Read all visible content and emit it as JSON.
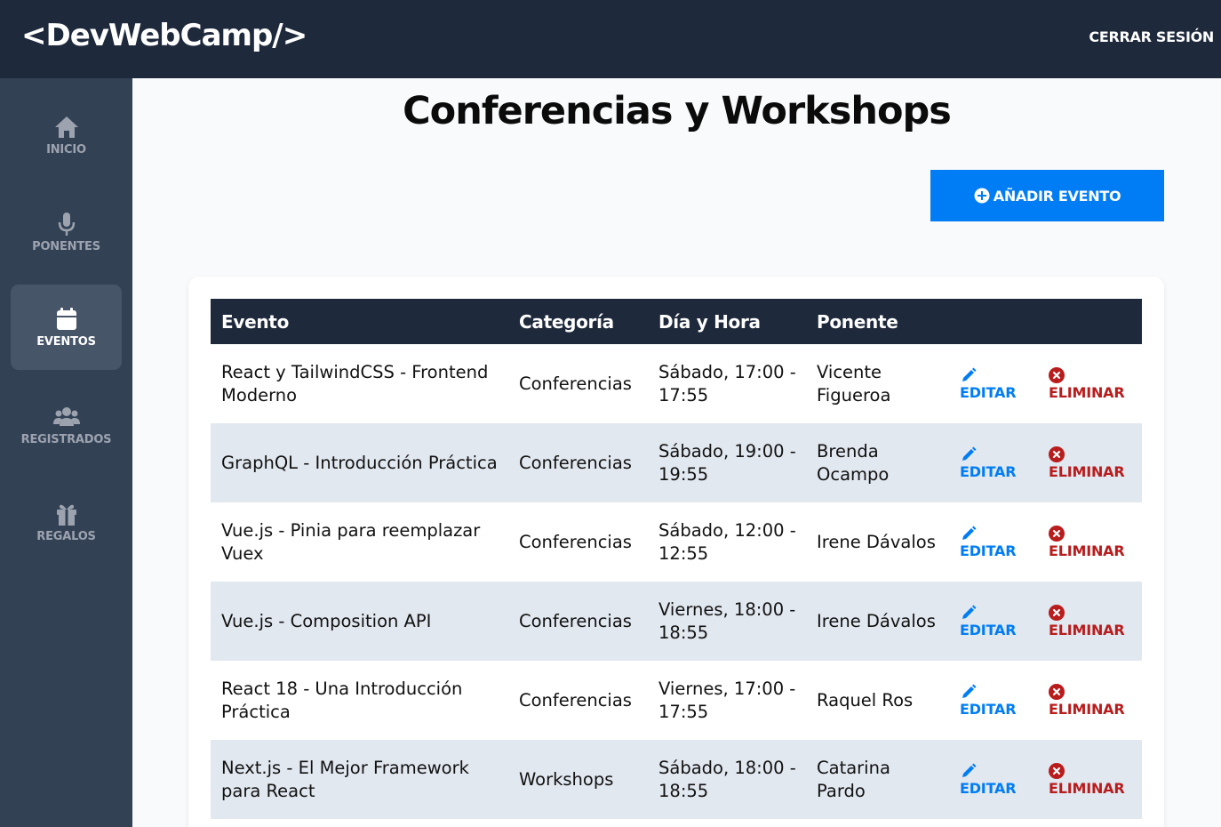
{
  "header": {
    "logo": "<DevWebCamp/>",
    "logout": "CERRAR SESIÓN"
  },
  "sidebar": {
    "items": [
      {
        "label": "INICIO",
        "icon": "home-icon"
      },
      {
        "label": "PONENTES",
        "icon": "microphone-icon"
      },
      {
        "label": "EVENTOS",
        "icon": "calendar-icon",
        "active": true
      },
      {
        "label": "REGISTRADOS",
        "icon": "users-icon"
      },
      {
        "label": "REGALOS",
        "icon": "gift-icon"
      }
    ]
  },
  "main": {
    "title": "Conferencias y Workshops",
    "add_button": "AÑADIR EVENTO",
    "table": {
      "headers": [
        "Evento",
        "Categoría",
        "Día y Hora",
        "Ponente"
      ],
      "edit_label": "EDITAR",
      "delete_label": "ELIMINAR",
      "rows": [
        {
          "evento": "React y TailwindCSS - Frontend Moderno",
          "categoria": "Conferencias",
          "dia_hora": "Sábado, 17:00 - 17:55",
          "ponente": "Vicente Figueroa"
        },
        {
          "evento": "GraphQL - Introducción Práctica",
          "categoria": "Conferencias",
          "dia_hora": "Sábado, 19:00 - 19:55",
          "ponente": "Brenda Ocampo"
        },
        {
          "evento": "Vue.js - Pinia para reemplazar Vuex",
          "categoria": "Conferencias",
          "dia_hora": "Sábado, 12:00 - 12:55",
          "ponente": "Irene Dávalos"
        },
        {
          "evento": "Vue.js - Composition API",
          "categoria": "Conferencias",
          "dia_hora": "Viernes, 18:00 - 18:55",
          "ponente": "Irene Dávalos"
        },
        {
          "evento": "React 18 - Una Introducción Práctica",
          "categoria": "Conferencias",
          "dia_hora": "Viernes, 17:00 - 17:55",
          "ponente": "Raquel Ros"
        },
        {
          "evento": "Next.js - El Mejor Framework para React",
          "categoria": "Workshops",
          "dia_hora": "Sábado, 18:00 - 18:55",
          "ponente": "Catarina Pardo"
        }
      ]
    }
  },
  "colors": {
    "topbar": "#1e293b",
    "sidebar": "#334155",
    "accent": "#007df4",
    "danger": "#b91c1c",
    "row_alt": "#e2e8f0"
  }
}
